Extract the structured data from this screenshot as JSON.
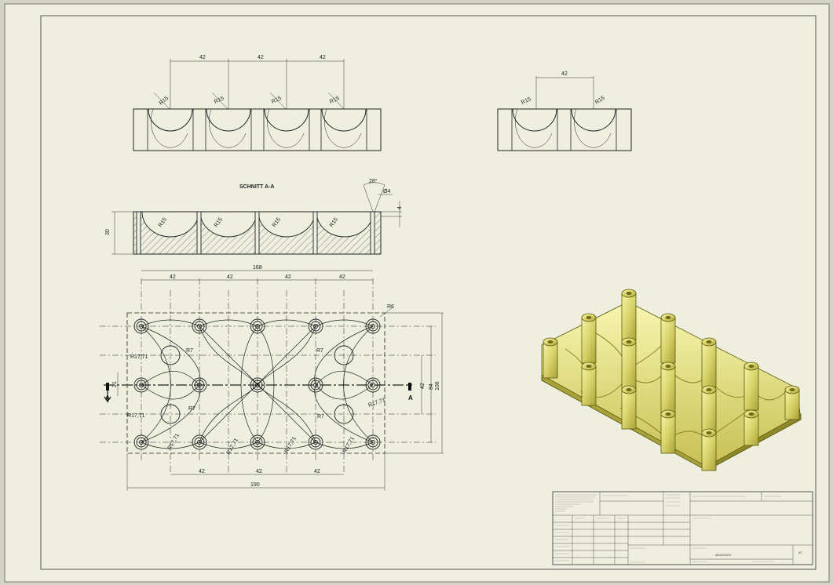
{
  "section": {
    "title": "SCHNITT A-A",
    "marker": "A"
  },
  "top_view": {
    "spacing": [
      "42",
      "42",
      "42"
    ],
    "radii": [
      "R15",
      "R15",
      "R15",
      "R15"
    ]
  },
  "side_view": {
    "spacing": "42",
    "radii": [
      "R15",
      "R15"
    ]
  },
  "section_view": {
    "height": "30",
    "angle": "28°",
    "hole": "Ø4",
    "depth": "4",
    "radii": [
      "R15",
      "R15",
      "R15",
      "R15"
    ]
  },
  "plan_view": {
    "overall_top": "168",
    "top_spacing": [
      "42",
      "42",
      "42",
      "42"
    ],
    "bottom_spacing": [
      "42",
      "42",
      "42"
    ],
    "overall_bottom": "190",
    "right_dims": [
      "42",
      "84",
      "106"
    ],
    "left_dim": "21",
    "corner_radius": "R6",
    "inner_radius": "R7",
    "edge_radius": "R17,71"
  },
  "title_block": {
    "drawing_number": "0612201513",
    "sheet_size": "A2"
  }
}
